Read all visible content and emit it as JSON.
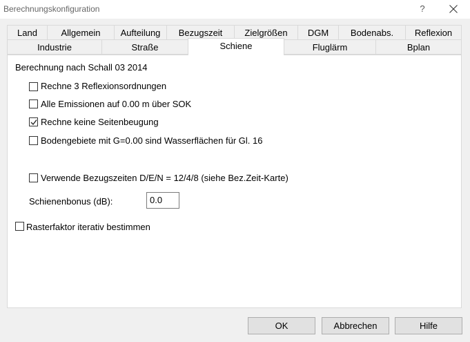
{
  "window": {
    "title": "Berechnungskonfiguration",
    "help_label": "?"
  },
  "tabs_row1": [
    {
      "label": "Land"
    },
    {
      "label": "Allgemein"
    },
    {
      "label": "Aufteilung"
    },
    {
      "label": "Bezugszeit"
    },
    {
      "label": "Zielgrößen"
    },
    {
      "label": "DGM"
    },
    {
      "label": "Bodenabs."
    },
    {
      "label": "Reflexion"
    }
  ],
  "tabs_row2": [
    {
      "label": "Industrie"
    },
    {
      "label": "Straße"
    },
    {
      "label": "Schiene",
      "active": true
    },
    {
      "label": "Fluglärm"
    },
    {
      "label": "Bplan"
    }
  ],
  "panel": {
    "heading": "Berechnung nach Schall 03 2014",
    "options": [
      {
        "label": "Rechne 3 Reflexionsordnungen",
        "checked": false
      },
      {
        "label": "Alle Emissionen auf 0.00 m über SOK",
        "checked": false
      },
      {
        "label": "Rechne keine Seitenbeugung",
        "checked": true
      },
      {
        "label": "Bodengebiete mit G=0.00 sind Wasserflächen für Gl. 16",
        "checked": false
      },
      {
        "label": "Verwende Bezugszeiten D/E/N = 12/4/8 (siehe Bez.Zeit-Karte)",
        "checked": false
      }
    ],
    "schienenbonus": {
      "label": "Schienenbonus (dB):",
      "value": "0.0"
    },
    "raster": {
      "label": "Rasterfaktor iterativ bestimmen",
      "checked": false
    }
  },
  "buttons": {
    "ok": "OK",
    "cancel": "Abbrechen",
    "help": "Hilfe"
  },
  "colors": {
    "dialog_bg": "#f0f0f0",
    "panel_bg": "#ffffff",
    "button_bg": "#e1e1e1",
    "border": "#d9d9d9"
  }
}
